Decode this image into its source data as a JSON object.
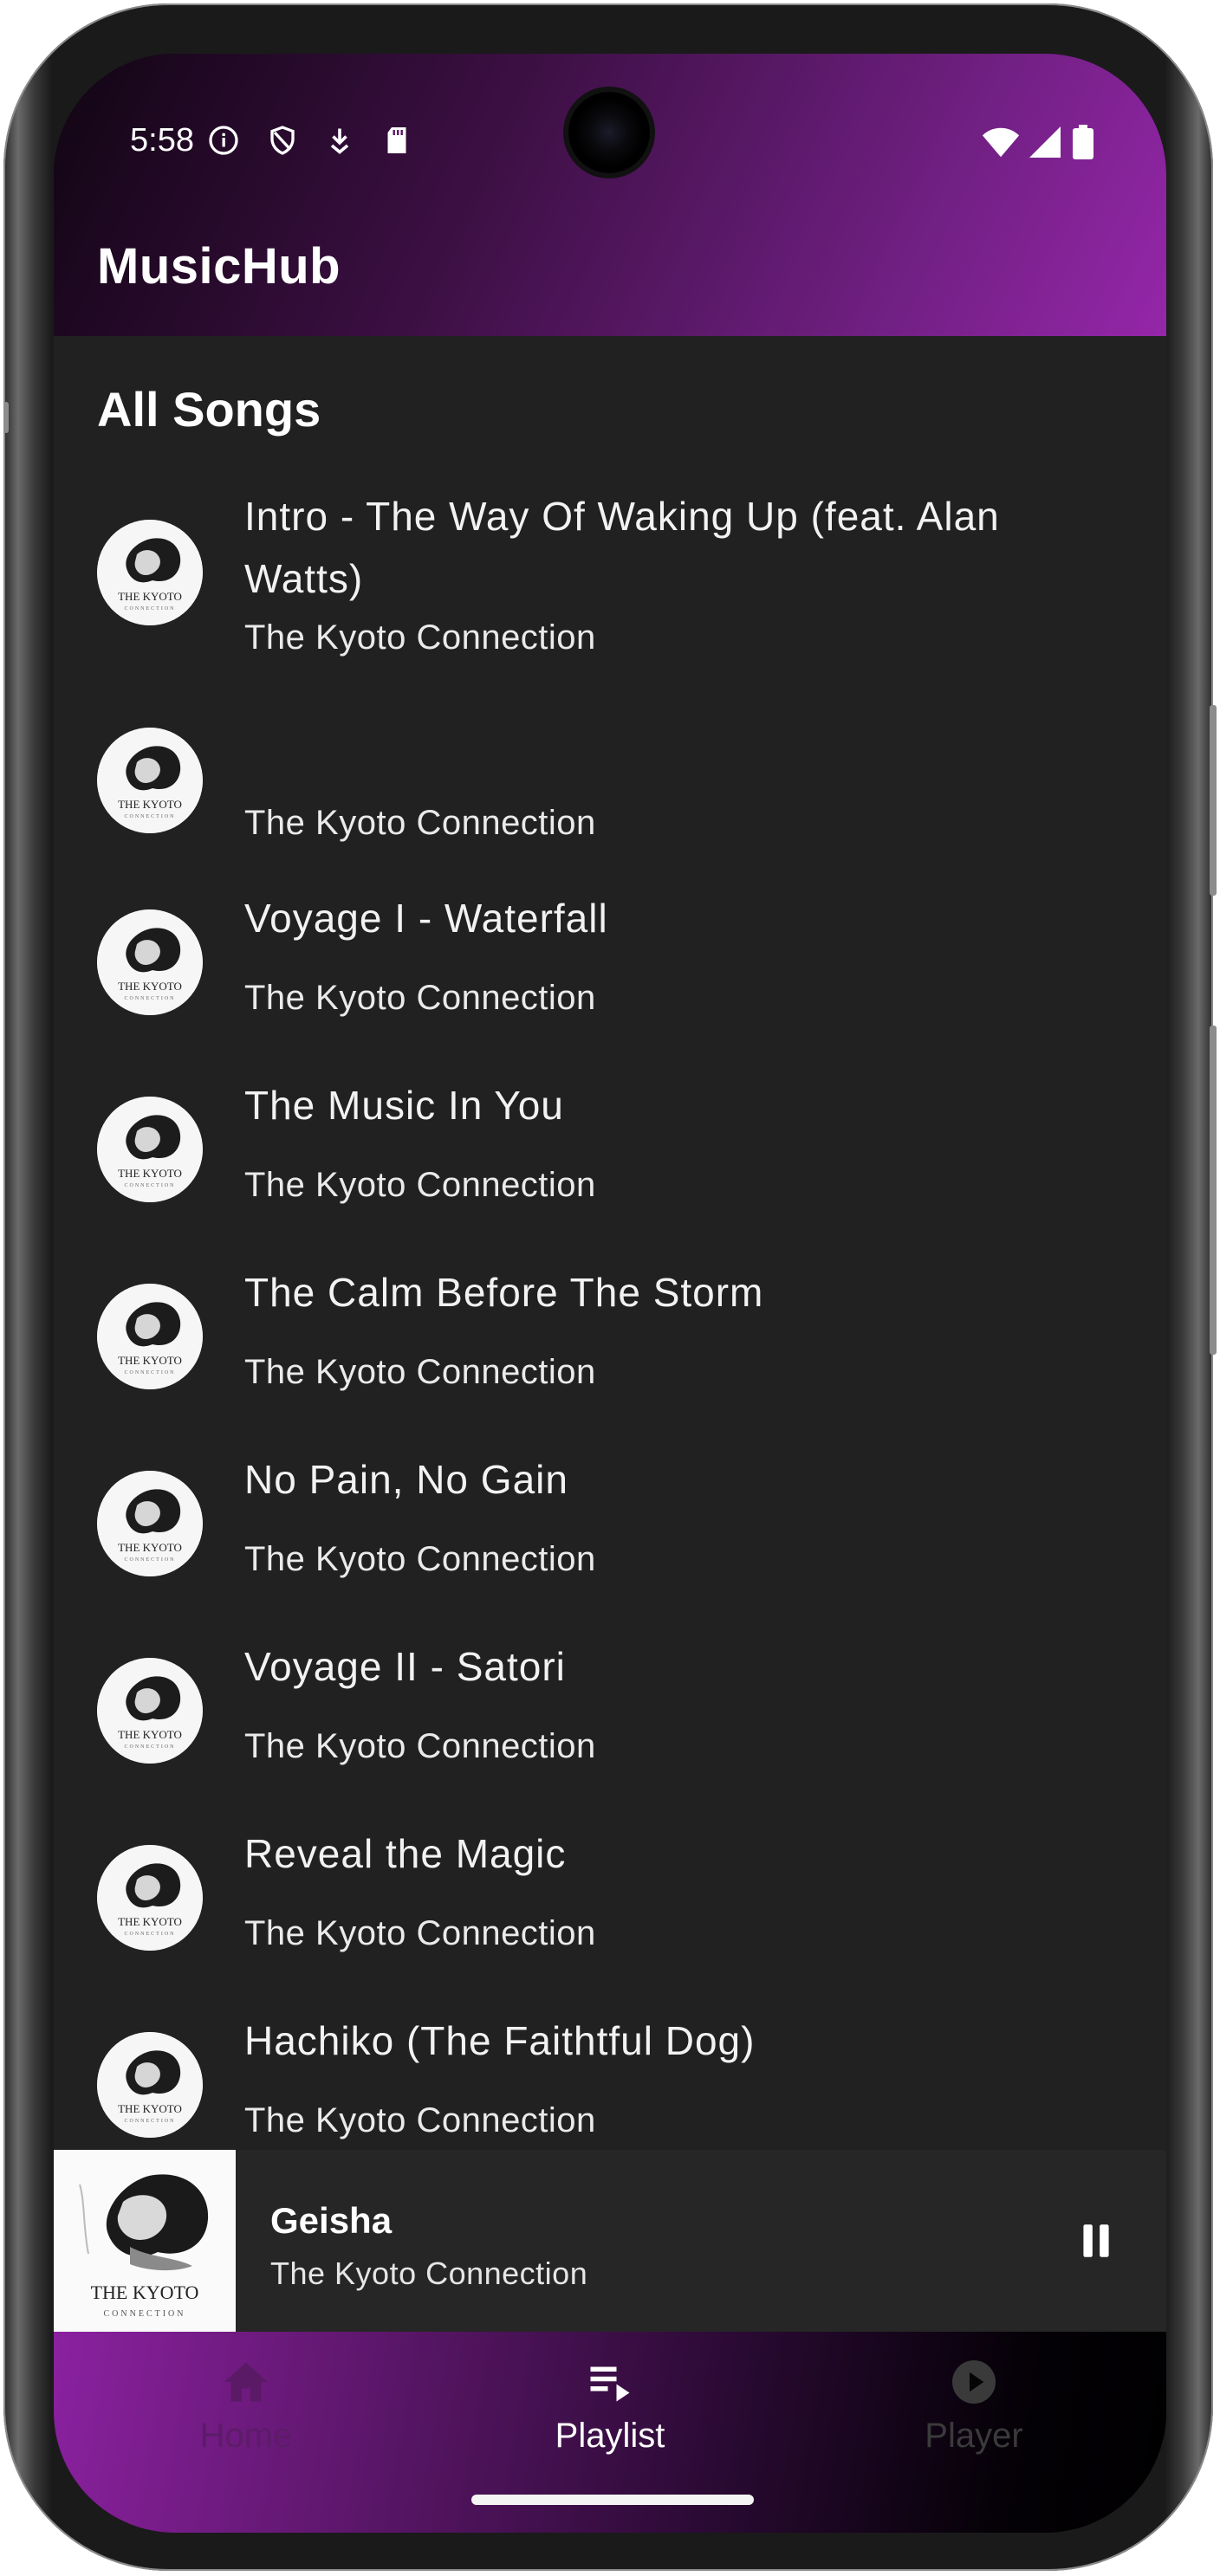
{
  "status_bar": {
    "time": "5:58"
  },
  "app_bar": {
    "title": "MusicHub"
  },
  "section": {
    "title": "All Songs"
  },
  "album_art": {
    "line1": "THE KYOTO",
    "line2": "CONNECTION"
  },
  "songs": [
    {
      "title": "Intro - The Way Of Waking Up (feat. Alan Watts)",
      "artist": "The Kyoto Connection"
    },
    {
      "title": "",
      "artist": "The Kyoto Connection"
    },
    {
      "title": "Voyage I - Waterfall",
      "artist": "The Kyoto Connection"
    },
    {
      "title": "The Music In You",
      "artist": "The Kyoto Connection"
    },
    {
      "title": "The Calm Before The Storm",
      "artist": "The Kyoto Connection"
    },
    {
      "title": "No Pain, No Gain",
      "artist": "The Kyoto Connection"
    },
    {
      "title": "Voyage II - Satori",
      "artist": "The Kyoto Connection"
    },
    {
      "title": "Reveal the Magic",
      "artist": "The Kyoto Connection"
    },
    {
      "title": "Hachiko (The Faithtful Dog)",
      "artist": "The Kyoto Connection"
    }
  ],
  "now_playing": {
    "title": "Geisha",
    "artist": "The Kyoto Connection",
    "state": "playing"
  },
  "nav": {
    "items": [
      {
        "label": "Home",
        "icon": "home-icon",
        "active": false
      },
      {
        "label": "Playlist",
        "icon": "playlist-play-icon",
        "active": true
      },
      {
        "label": "Player",
        "icon": "play-circle-icon",
        "active": false
      }
    ]
  },
  "colors": {
    "accent": "#9526a9",
    "list_background": "#212121",
    "active_nav": "#ffffff",
    "inactive_nav": "#3a3a3a"
  }
}
